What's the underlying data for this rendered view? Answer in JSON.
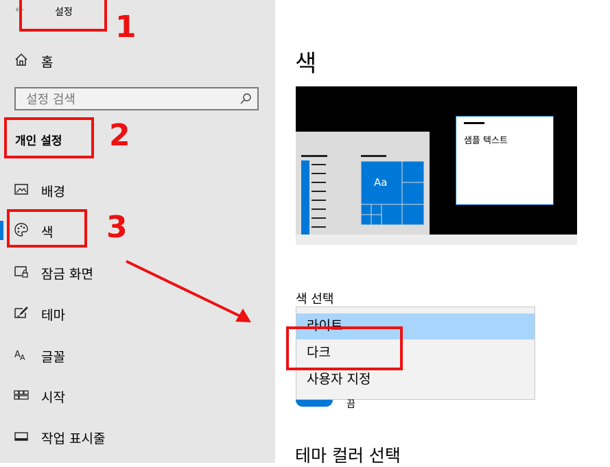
{
  "window": {
    "title": "설정",
    "back_icon": "back-arrow-icon"
  },
  "sidebar": {
    "home_label": "홈",
    "search_placeholder": "설정 검색",
    "section_heading": "개인 설정",
    "items": [
      {
        "label": "배경",
        "icon": "picture-icon"
      },
      {
        "label": "색",
        "icon": "palette-icon",
        "selected": true
      },
      {
        "label": "잠금 화면",
        "icon": "lock-screen-icon"
      },
      {
        "label": "테마",
        "icon": "theme-brush-icon"
      },
      {
        "label": "글꼴",
        "icon": "font-icon"
      },
      {
        "label": "시작",
        "icon": "start-grid-icon"
      },
      {
        "label": "작업 표시줄",
        "icon": "taskbar-icon"
      }
    ]
  },
  "main": {
    "title": "색",
    "preview": {
      "sample_text": "샘플 텍스트",
      "tile_label": "Aa"
    },
    "color_select": {
      "label": "색 선택",
      "options": [
        "라이트",
        "다크",
        "사용자 지정"
      ],
      "highlighted": "라이트"
    },
    "toggle_peek_label": "끔",
    "section_theme_color": "테마 컬러 선택"
  },
  "annotations": {
    "numbers": [
      "1",
      "2",
      "3"
    ],
    "color": "#ee1111"
  },
  "colors": {
    "accent": "#0078d7",
    "sidebar_bg": "#e6e6e6",
    "dropdown_highlight": "#a8d5fb"
  }
}
